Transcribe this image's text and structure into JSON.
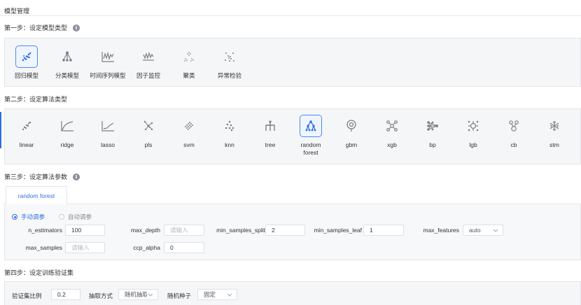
{
  "page": {
    "title": "模型管理"
  },
  "step1": {
    "title": "第一步：设定模型类型",
    "info_icon": "info-circle-icon",
    "items": [
      {
        "label": "回归模型",
        "icon": "scatter-regression-icon",
        "selected": true
      },
      {
        "label": "分类模型",
        "icon": "classification-tree-icon",
        "selected": false
      },
      {
        "label": "时间序列模型",
        "icon": "time-series-icon",
        "selected": false
      },
      {
        "label": "因子监控",
        "icon": "factor-monitor-icon",
        "selected": false
      },
      {
        "label": "聚类",
        "icon": "cluster-icon",
        "selected": false
      },
      {
        "label": "异常检验",
        "icon": "anomaly-detection-icon",
        "selected": false
      }
    ]
  },
  "step2": {
    "title": "第二步：设定算法类型",
    "items": [
      {
        "label": "linear",
        "icon": "linear-scatter-icon",
        "selected": false
      },
      {
        "label": "ridge",
        "icon": "ridge-curve-icon",
        "selected": false
      },
      {
        "label": "lasso",
        "icon": "lasso-curve-icon",
        "selected": false
      },
      {
        "label": "pls",
        "icon": "pls-icon",
        "selected": false
      },
      {
        "label": "svm",
        "icon": "svm-icon",
        "selected": false
      },
      {
        "label": "knn",
        "icon": "knn-icon",
        "selected": false
      },
      {
        "label": "tree",
        "icon": "tree-icon",
        "selected": false
      },
      {
        "label": "random forest",
        "icon": "random-forest-icon",
        "selected": true
      },
      {
        "label": "gbm",
        "icon": "gbm-icon",
        "selected": false
      },
      {
        "label": "xgb",
        "icon": "xgb-icon",
        "selected": false
      },
      {
        "label": "bp",
        "icon": "bp-network-icon",
        "selected": false
      },
      {
        "label": "lgb",
        "icon": "lgb-icon",
        "selected": false
      },
      {
        "label": "cb",
        "icon": "cb-icon",
        "selected": false
      },
      {
        "label": "stm",
        "icon": "stm-icon",
        "selected": false
      }
    ]
  },
  "step3": {
    "title": "第三步：设定算法参数",
    "tab": "random forest",
    "mode_manual": "手动调参",
    "mode_auto": "自动调参",
    "params": {
      "n_estimators": {
        "label": "n_estimators",
        "value": "100"
      },
      "max_depth": {
        "label": "max_depth",
        "placeholder": "请输入"
      },
      "min_samples_split": {
        "label": "min_samples_split",
        "value": "2"
      },
      "min_samples_leaf": {
        "label": "min_samples_leaf",
        "value": "1"
      },
      "max_features": {
        "label": "max_features",
        "value": "auto"
      },
      "max_samples": {
        "label": "max_samples",
        "placeholder": "请输入"
      },
      "ccp_alpha": {
        "label": "ccp_alpha",
        "value": "0"
      }
    }
  },
  "step4": {
    "title": "第四步：设定训练验证集",
    "ratio_label": "验证集比例",
    "ratio_value": "0.2",
    "method_label": "抽取方式",
    "method_value": "随机抽取",
    "seed_label": "随机种子",
    "seed_value": "固定"
  },
  "colors": {
    "accent": "#2f6fe0",
    "icon_gray": "#7b8089"
  }
}
